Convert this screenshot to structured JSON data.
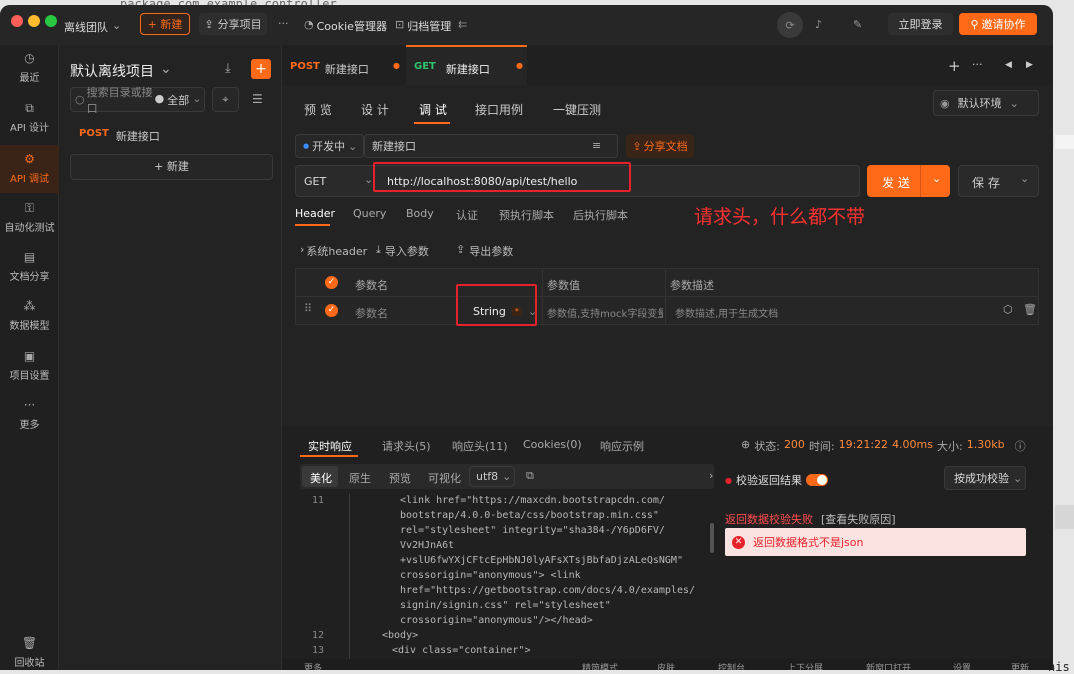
{
  "background": {
    "code_line": "package com.example.controller",
    "right_edge_text": "nis"
  },
  "titlebar": {
    "team": "离线团队",
    "new_button": "+ 新建",
    "share_project": "分享项目",
    "more": "···",
    "cookie_manager": "Cookie管理器",
    "archive": "归档管理",
    "login": "立即登录",
    "invite": "邀请协作"
  },
  "sidebar": {
    "items": [
      {
        "label": "最近",
        "icon": "clock-icon"
      },
      {
        "label": "API 设计",
        "icon": "api-design-icon"
      },
      {
        "label": "API 调试",
        "icon": "api-debug-icon"
      },
      {
        "label": "自动化测试",
        "icon": "automation-icon"
      },
      {
        "label": "文档分享",
        "icon": "doc-share-icon"
      },
      {
        "label": "数据模型",
        "icon": "data-model-icon"
      },
      {
        "label": "项目设置",
        "icon": "settings-icon"
      },
      {
        "label": "更多",
        "icon": "more-icon"
      }
    ],
    "recycle": "回收站"
  },
  "tree": {
    "project": "默认离线项目",
    "search_placeholder": "搜索目录或接口",
    "filter": "全部",
    "item_method": "POST",
    "item_name": "新建接口",
    "new_label": "+ 新建"
  },
  "tabs": [
    {
      "method": "POST",
      "name": "新建接口"
    },
    {
      "method": "GET",
      "name": "新建接口"
    }
  ],
  "subtabs": [
    "预 览",
    "设 计",
    "调 试",
    "接口用例",
    "一键压测"
  ],
  "env": "默认环境",
  "status_env": "开发中",
  "api_name": "新建接口",
  "share_doc": "分享文档",
  "request": {
    "method": "GET",
    "url": "http://localhost:8080/api/test/hello",
    "send": "发 送",
    "save": "保 存"
  },
  "annotation": "请求头，什么都不带",
  "param_tabs": [
    "Header",
    "Query",
    "Body",
    "认证",
    "预执行脚本",
    "后执行脚本"
  ],
  "header_tools": [
    "系统header",
    "导入参数",
    "导出参数"
  ],
  "table": {
    "headers": [
      "参数名",
      "参数值",
      "参数描述"
    ],
    "row": {
      "name_placeholder": "参数名",
      "type": "String",
      "value_placeholder": "参数值,支持mock字段变量",
      "desc_placeholder": "参数描述,用于生成文档"
    }
  },
  "response": {
    "tabs": [
      "实时响应",
      "请求头(5)",
      "响应头(11)",
      "Cookies(0)",
      "响应示例"
    ],
    "status_label": "状态:",
    "status": "200",
    "time_label": "时间:",
    "time": "19:21:22",
    "duration": "4.00ms",
    "size_label": "大小:",
    "size": "1.30kb",
    "view_tabs": [
      "美化",
      "原生",
      "预览",
      "可视化"
    ],
    "encoding": "utf8",
    "validate": "校验返回结果",
    "validate_mode": "按成功校验",
    "fail_title": "返回数据校验失败",
    "fail_link": "[查看失败原因]",
    "fail_msg": "返回数据格式不是json",
    "code_lines": [
      {
        "n": "11",
        "t": "<link href=\"https://maxcdn.bootstrapcdn.com/"
      },
      {
        "n": "",
        "t": "bootstrap/4.0.0-beta/css/bootstrap.min.css\""
      },
      {
        "n": "",
        "t": "rel=\"stylesheet\" integrity=\"sha384-/Y6pD6FV/"
      },
      {
        "n": "",
        "t": "Vv2HJnA6t"
      },
      {
        "n": "",
        "t": "+vslU6fwYXjCFtcEpHbNJ0lyAFsXTsjBbfaDjzALeQsNGM\""
      },
      {
        "n": "",
        "t": "crossorigin=\"anonymous\">         <link"
      },
      {
        "n": "",
        "t": "href=\"https://getbootstrap.com/docs/4.0/examples/"
      },
      {
        "n": "",
        "t": "signin/signin.css\" rel=\"stylesheet\""
      },
      {
        "n": "",
        "t": "crossorigin=\"anonymous\"/></head>"
      },
      {
        "n": "12",
        "t": "<body>"
      },
      {
        "n": "13",
        "t": "<div class=\"container\">"
      }
    ]
  },
  "footer": [
    "更多",
    "精简模式",
    "皮肤",
    "控制台",
    "上下分屏",
    "新窗口打开",
    "设置",
    "更新"
  ]
}
